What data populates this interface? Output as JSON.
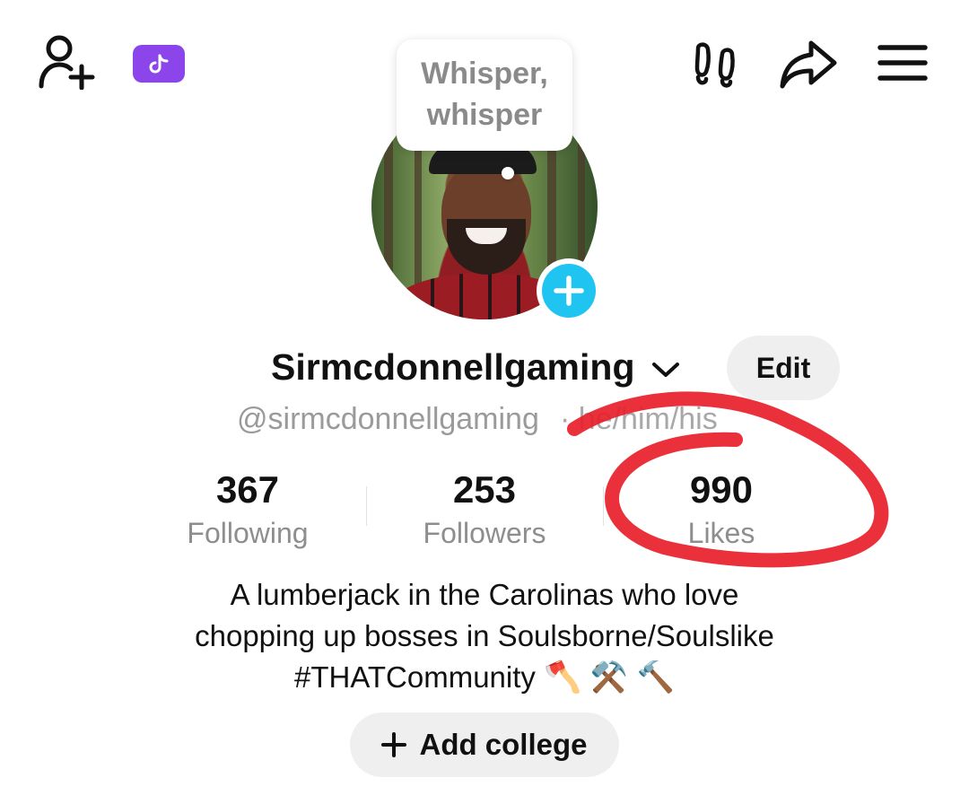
{
  "header": {
    "add_friend_icon": "person-plus-icon",
    "ticket_icon": "tiktok-ticket-icon",
    "footprints_icon": "footprints-icon",
    "share_icon": "share-arrow-icon",
    "menu_icon": "hamburger-menu-icon"
  },
  "profile": {
    "speech_bubble_line1": "Whisper,",
    "speech_bubble_line2": "whisper",
    "display_name": "Sirmcdonnellgaming",
    "edit_label": "Edit",
    "handle": "@sirmcdonnellgaming",
    "handle_tail": "· he/him/his",
    "stats": [
      {
        "value": "367",
        "label": "Following"
      },
      {
        "value": "253",
        "label": "Followers"
      },
      {
        "value": "990",
        "label": "Likes"
      }
    ],
    "bio_lines": [
      "A lumberjack in the Carolinas who love",
      "chopping up bosses in Soulsborne/Soulslike",
      "#THATCommunity"
    ],
    "bio_emojis": "🪓 ⚒️ 🔨",
    "add_college_label": "Add college"
  },
  "colors": {
    "accent_blue": "#20c4f0",
    "ticket_purple": "#8b45ea",
    "annotation_red": "#e8202a"
  }
}
